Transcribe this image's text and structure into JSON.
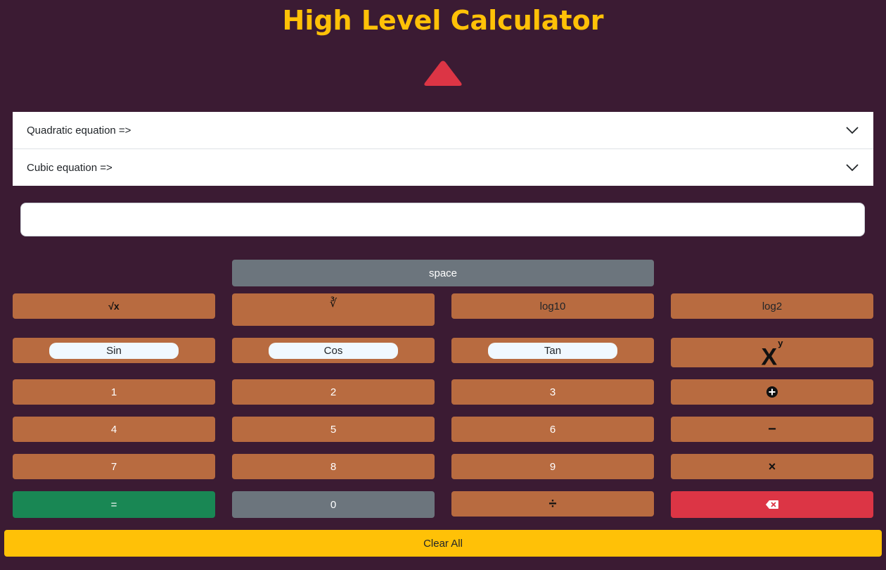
{
  "header": {
    "title": "High Level Calculator"
  },
  "accordion": {
    "items": [
      {
        "label": "Quadratic equation =>"
      },
      {
        "label": "Cubic equation =>"
      }
    ]
  },
  "display": {
    "value": "",
    "placeholder": ""
  },
  "keys": {
    "space": "space",
    "sqrt": "√x",
    "cbrt": "∛",
    "log10": "log10",
    "log2": "log2",
    "sin": "Sin",
    "cos": "Cos",
    "tan": "Tan",
    "power_base": "X",
    "power_exp": "y",
    "one": "1",
    "two": "2",
    "three": "3",
    "four": "4",
    "five": "5",
    "six": "6",
    "seven": "7",
    "eight": "8",
    "nine": "9",
    "equals": "=",
    "zero": "0",
    "divide": "÷",
    "multiply": "×",
    "minus": "−",
    "clear_all": "Clear All"
  },
  "icons": {
    "toggle": "caret-up-icon",
    "accordion_chevron": "chevron-down-icon",
    "plus": "plus-circle-icon",
    "backspace": "backspace-icon"
  },
  "colors": {
    "background": "#3b1b33",
    "title": "#ffc107",
    "key": "#b86b40",
    "gray": "#6c757d",
    "equals": "#198754",
    "backspace": "#dc3545",
    "clear": "#ffc107",
    "toggle": "#dc3545"
  }
}
